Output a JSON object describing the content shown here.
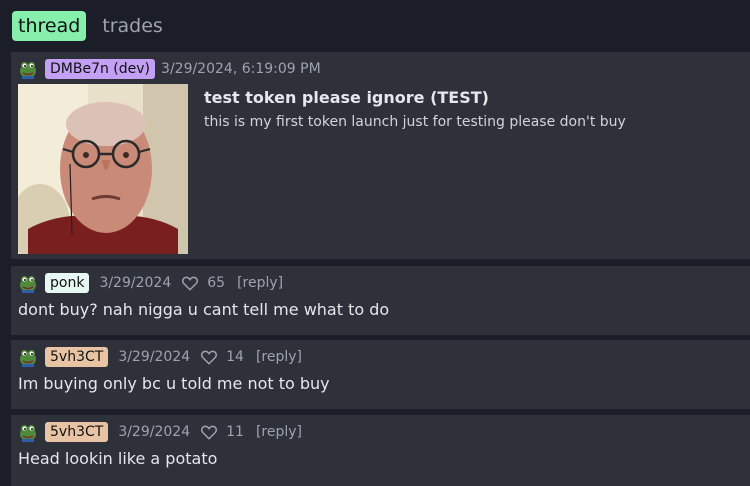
{
  "tabs": [
    {
      "label": "thread"
    },
    {
      "label": "trades"
    }
  ],
  "post": {
    "username": "DMBe7n (dev)",
    "timestamp": "3/29/2024, 6:19:09 PM",
    "title": "test token please ignore (TEST)",
    "description": "this is my first token launch just for testing please don't buy"
  },
  "replies": [
    {
      "username": "ponk",
      "date": "3/29/2024",
      "likes": "65",
      "reply_label": "[reply]",
      "text": "dont buy? nah nigga u cant tell me what to do"
    },
    {
      "username": "5vh3CT",
      "date": "3/29/2024",
      "likes": "14",
      "reply_label": "[reply]",
      "text": "Im buying only bc u told me not to buy"
    },
    {
      "username": "5vh3CT",
      "date": "3/29/2024",
      "likes": "11",
      "reply_label": "[reply]",
      "text": "Head lookin like a potato"
    }
  ],
  "icons": {
    "avatar": "pepe-frog-icon",
    "like": "heart-icon"
  },
  "colors": {
    "active_tab": "#86efac",
    "dev_badge": "#c4a0f4",
    "ponk_badge": "#e7f7f2",
    "user_badge": "#e9c4a4",
    "card_bg": "#2e303a",
    "page_bg": "#1b1d28"
  }
}
